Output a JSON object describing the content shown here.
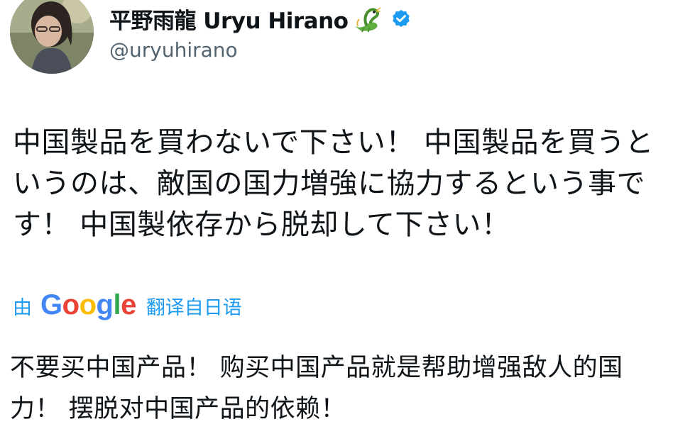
{
  "author": {
    "display_name": "平野雨龍 Uryu Hirano",
    "handle": "@uryuhirano",
    "badge_emoji": "dragon-emoji",
    "verified": true,
    "verified_color": "#1d9bf0"
  },
  "tweet": {
    "text": "中国製品を買わないで下さい！ 中国製品を買うと\nいうのは、敵国の国力増強に協力するという事で\nす！ 中国製依存から脱却して下さい！"
  },
  "translation": {
    "prefix": "由",
    "provider": "Google",
    "suffix": "翻译自日语",
    "link_color": "#1d9bf0",
    "text": "不要买中国产品！ 购买中国产品就是帮助增强敌人的国\n力！ 摆脱对中国产品的依赖！"
  }
}
